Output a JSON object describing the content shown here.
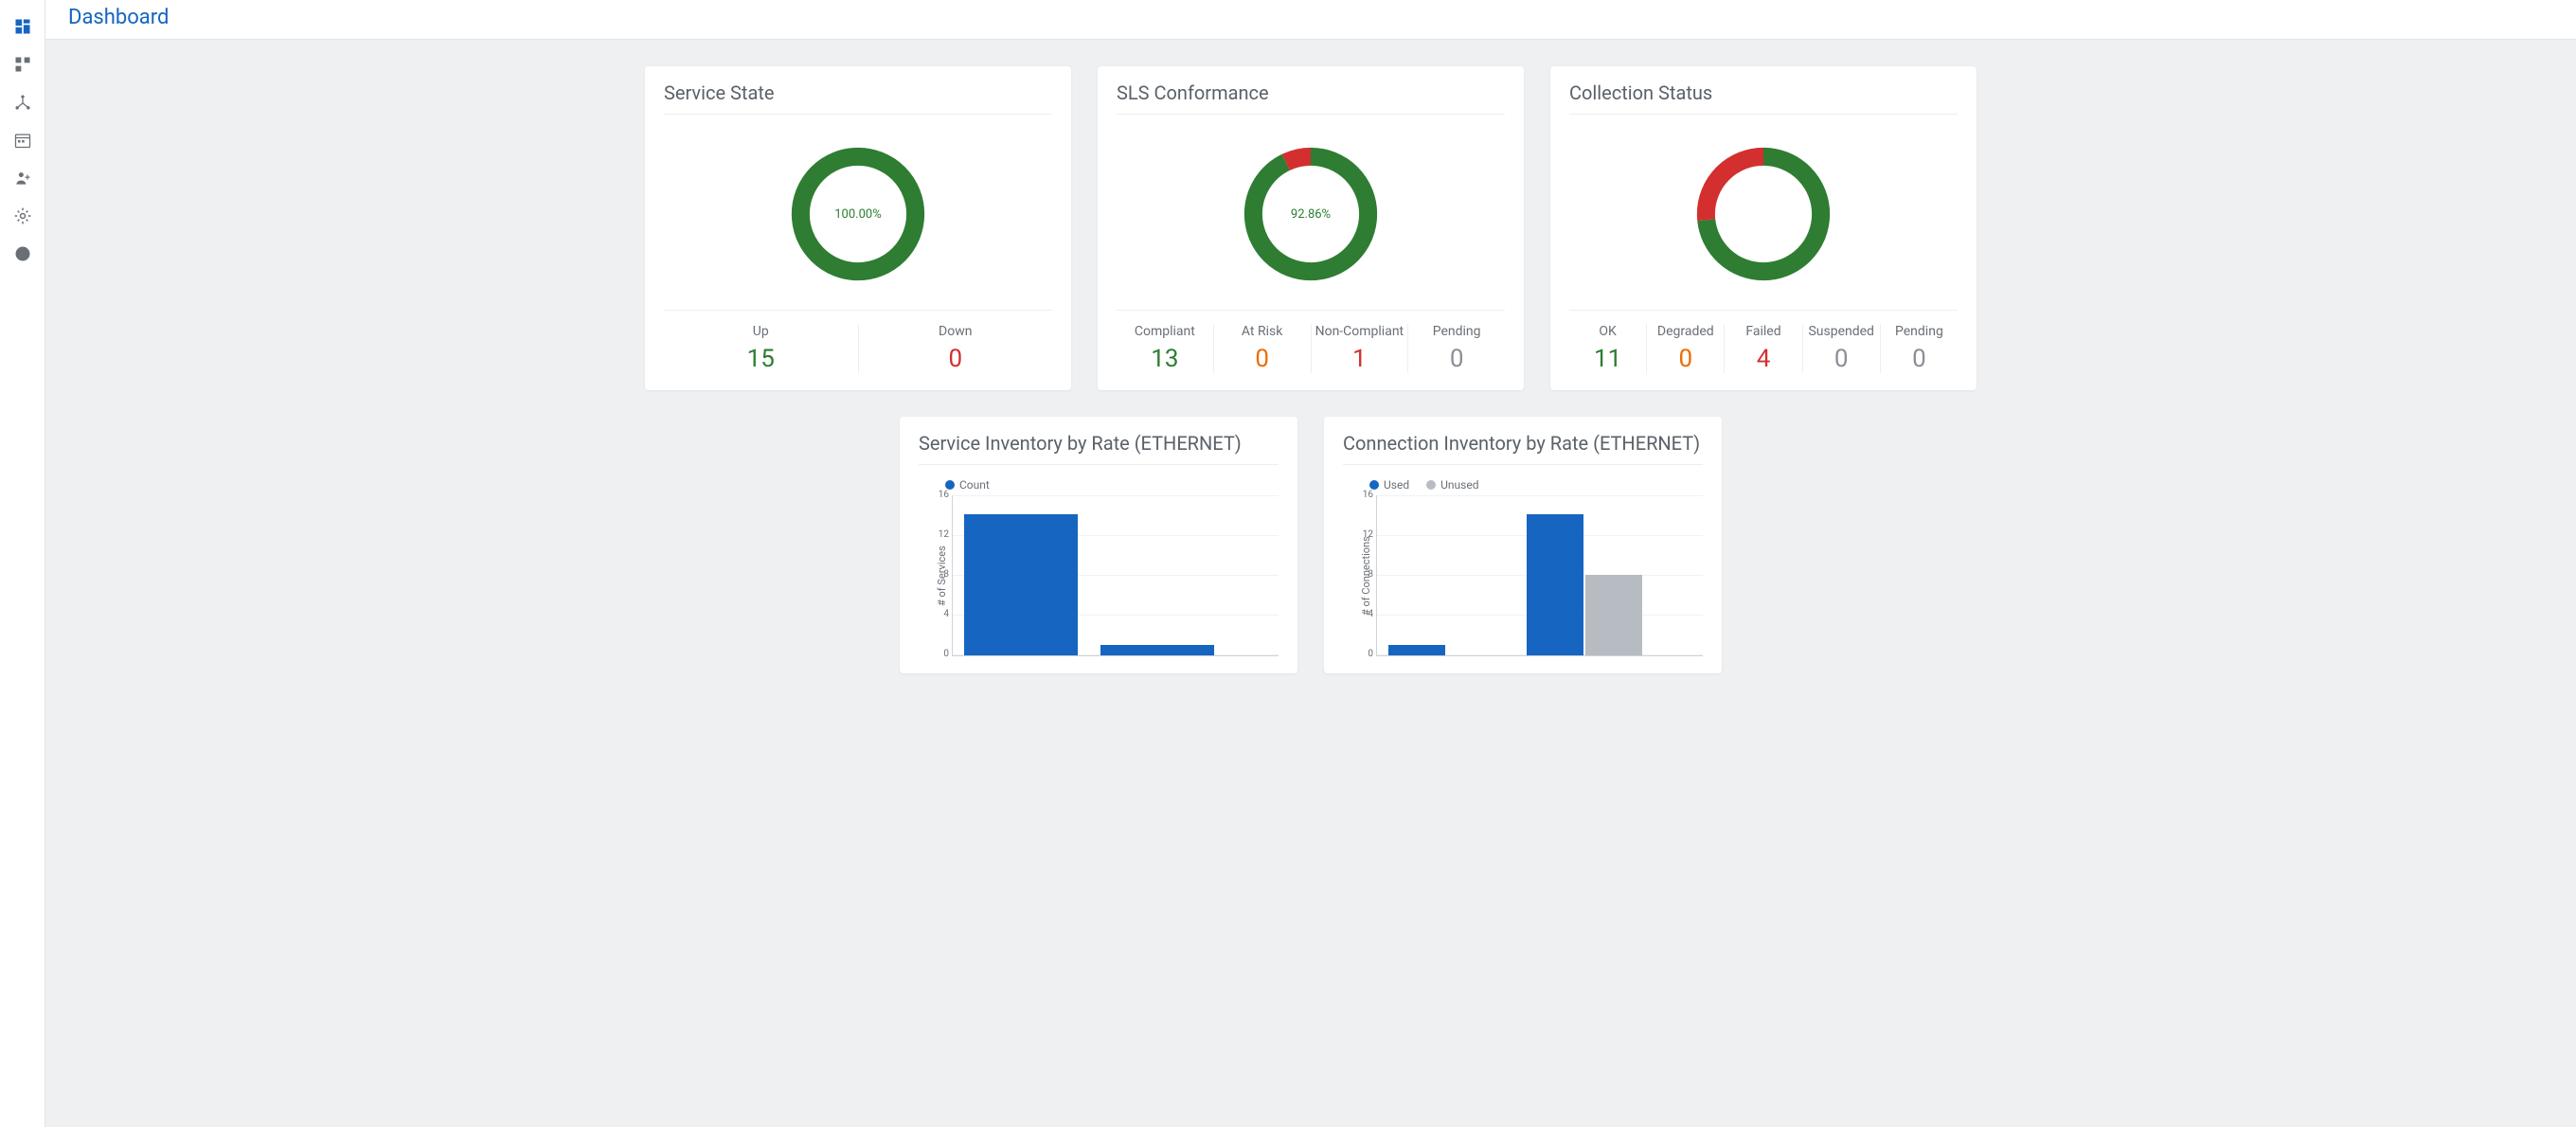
{
  "page": {
    "title": "Dashboard"
  },
  "sidebar": {
    "items": [
      {
        "icon": "dashboard",
        "active": true
      },
      {
        "icon": "category"
      },
      {
        "icon": "network"
      },
      {
        "icon": "calendar"
      },
      {
        "icon": "person-add"
      },
      {
        "icon": "settings"
      },
      {
        "icon": "info"
      }
    ]
  },
  "colors": {
    "green": "#2e7d32",
    "red": "#d32f2f",
    "orange": "#ef6c00",
    "gray": "#8a8f95",
    "blue": "#1665c0",
    "lightgray": "#b7bcc2"
  },
  "cards": {
    "service_state": {
      "title": "Service State",
      "center": "100.00%",
      "donut": {
        "green": 100,
        "red": 0
      },
      "stats": [
        {
          "label": "Up",
          "value": "15",
          "color": "#2e7d32"
        },
        {
          "label": "Down",
          "value": "0",
          "color": "#d32f2f"
        }
      ]
    },
    "sls_conformance": {
      "title": "SLS Conformance",
      "center": "92.86%",
      "donut": {
        "green": 92.86,
        "red": 7.14
      },
      "stats": [
        {
          "label": "Compliant",
          "value": "13",
          "color": "#2e7d32"
        },
        {
          "label": "At Risk",
          "value": "0",
          "color": "#ef6c00"
        },
        {
          "label": "Non-Compliant",
          "value": "1",
          "color": "#d32f2f"
        },
        {
          "label": "Pending",
          "value": "0",
          "color": "#8a8f95"
        }
      ]
    },
    "collection_status": {
      "title": "Collection Status",
      "center": "",
      "donut": {
        "green": 73.33,
        "red": 26.67
      },
      "stats": [
        {
          "label": "OK",
          "value": "11",
          "color": "#2e7d32"
        },
        {
          "label": "Degraded",
          "value": "0",
          "color": "#ef6c00"
        },
        {
          "label": "Failed",
          "value": "4",
          "color": "#d32f2f"
        },
        {
          "label": "Suspended",
          "value": "0",
          "color": "#8a8f95"
        },
        {
          "label": "Pending",
          "value": "0",
          "color": "#8a8f95"
        }
      ]
    },
    "service_inventory": {
      "title": "Service Inventory by Rate (ETHERNET)",
      "legend": [
        {
          "label": "Count",
          "color": "#1665c0"
        }
      ],
      "ylabel": "# of Services"
    },
    "connection_inventory": {
      "title": "Connection Inventory by Rate (ETHERNET)",
      "legend": [
        {
          "label": "Used",
          "color": "#1665c0"
        },
        {
          "label": "Unused",
          "color": "#b7bcc2"
        }
      ],
      "ylabel": "# of Connections"
    }
  },
  "chart_data": [
    {
      "id": "service_state_donut",
      "type": "pie",
      "series": [
        {
          "name": "Up",
          "value": 15,
          "color": "#2e7d32"
        },
        {
          "name": "Down",
          "value": 0,
          "color": "#d32f2f"
        }
      ],
      "center_label": "100.00%"
    },
    {
      "id": "sls_conformance_donut",
      "type": "pie",
      "series": [
        {
          "name": "Compliant",
          "value": 13,
          "color": "#2e7d32"
        },
        {
          "name": "At Risk",
          "value": 0,
          "color": "#ef6c00"
        },
        {
          "name": "Non-Compliant",
          "value": 1,
          "color": "#d32f2f"
        },
        {
          "name": "Pending",
          "value": 0,
          "color": "#8a8f95"
        }
      ],
      "center_label": "92.86%"
    },
    {
      "id": "collection_status_donut",
      "type": "pie",
      "series": [
        {
          "name": "OK",
          "value": 11,
          "color": "#2e7d32"
        },
        {
          "name": "Degraded",
          "value": 0,
          "color": "#ef6c00"
        },
        {
          "name": "Failed",
          "value": 4,
          "color": "#d32f2f"
        },
        {
          "name": "Suspended",
          "value": 0,
          "color": "#8a8f95"
        },
        {
          "name": "Pending",
          "value": 0,
          "color": "#8a8f95"
        }
      ],
      "center_label": ""
    },
    {
      "id": "service_inventory_bar",
      "type": "bar",
      "title": "Service Inventory by Rate (ETHERNET)",
      "ylabel": "# of Services",
      "ylim": [
        0,
        16
      ],
      "yticks": [
        0,
        4,
        8,
        12,
        16
      ],
      "series": [
        {
          "name": "Count",
          "color": "#1665c0",
          "values": [
            14,
            1
          ]
        }
      ],
      "categories": [
        "",
        ""
      ]
    },
    {
      "id": "connection_inventory_bar",
      "type": "bar",
      "title": "Connection Inventory by Rate (ETHERNET)",
      "ylabel": "# of Connections",
      "ylim": [
        0,
        16
      ],
      "yticks": [
        0,
        4,
        8,
        12,
        16
      ],
      "series": [
        {
          "name": "Used",
          "color": "#1665c0",
          "values": [
            1,
            14
          ]
        },
        {
          "name": "Unused",
          "color": "#b7bcc2",
          "values": [
            0,
            8
          ]
        }
      ],
      "categories": [
        "",
        ""
      ]
    }
  ]
}
